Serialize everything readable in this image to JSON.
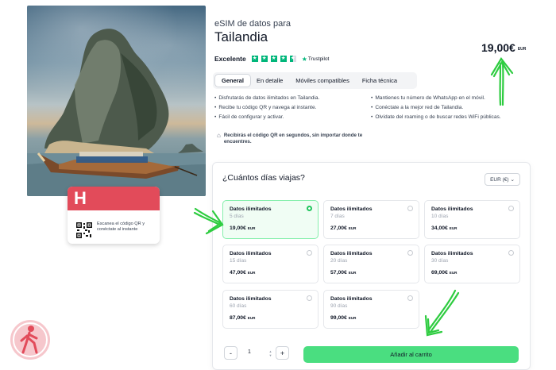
{
  "product": {
    "subtitle": "eSIM de datos para",
    "title": "Tailandia",
    "price": "19,00€",
    "price_currency": "EUR"
  },
  "rating": {
    "label": "Excelente",
    "stars": 4.5,
    "provider": "Trustpilot",
    "star_color": "#00b67a"
  },
  "tabs": [
    {
      "label": "General",
      "active": true
    },
    {
      "label": "En detalle",
      "active": false
    },
    {
      "label": "Móviles compatibles",
      "active": false
    },
    {
      "label": "Ficha técnica",
      "active": false
    }
  ],
  "features_left": [
    "Disfrutarás de datos ilimitados en Tailandia.",
    "Recibe tu código QR y navega al instante.",
    "Fácil de configurar y activar."
  ],
  "features_right": [
    "Mantienes tu número de WhatsApp en el móvil.",
    "Conéctate a la mejor red de Tailandia.",
    "Olvídate del roaming o de buscar redes WiFi públicas."
  ],
  "note": "Recibirás el código QR en segundos, sin importar donde te encuentres.",
  "esim_card": {
    "logo": "H",
    "qr_text": "Escanea el código QR y conéctate al instante",
    "brand_color": "#e24b5a"
  },
  "days": {
    "question": "¿Cuántos días viajas?",
    "currency_selector": "EUR (€)",
    "options": [
      {
        "name": "Datos ilimitados",
        "days": "5 días",
        "price": "19,00€",
        "currency": "EUR",
        "selected": true
      },
      {
        "name": "Datos ilimitados",
        "days": "7 días",
        "price": "27,00€",
        "currency": "EUR",
        "selected": false
      },
      {
        "name": "Datos ilimitados",
        "days": "10 días",
        "price": "34,00€",
        "currency": "EUR",
        "selected": false
      },
      {
        "name": "Datos ilimitados",
        "days": "15 días",
        "price": "47,00€",
        "currency": "EUR",
        "selected": false
      },
      {
        "name": "Datos ilimitados",
        "days": "20 días",
        "price": "57,00€",
        "currency": "EUR",
        "selected": false
      },
      {
        "name": "Datos ilimitados",
        "days": "30 días",
        "price": "69,00€",
        "currency": "EUR",
        "selected": false
      },
      {
        "name": "Datos ilimitados",
        "days": "60 días",
        "price": "87,00€",
        "currency": "EUR",
        "selected": false
      },
      {
        "name": "Datos ilimitados",
        "days": "90 días",
        "price": "99,00€",
        "currency": "EUR",
        "selected": false
      }
    ]
  },
  "cart": {
    "minus": "-",
    "quantity": "1",
    "plus": "+",
    "add_label": "Añadir al carrito",
    "accent": "#4ade80"
  },
  "icons": {
    "note_icon": "tag-icon",
    "watermark": "walking-person-logo"
  }
}
